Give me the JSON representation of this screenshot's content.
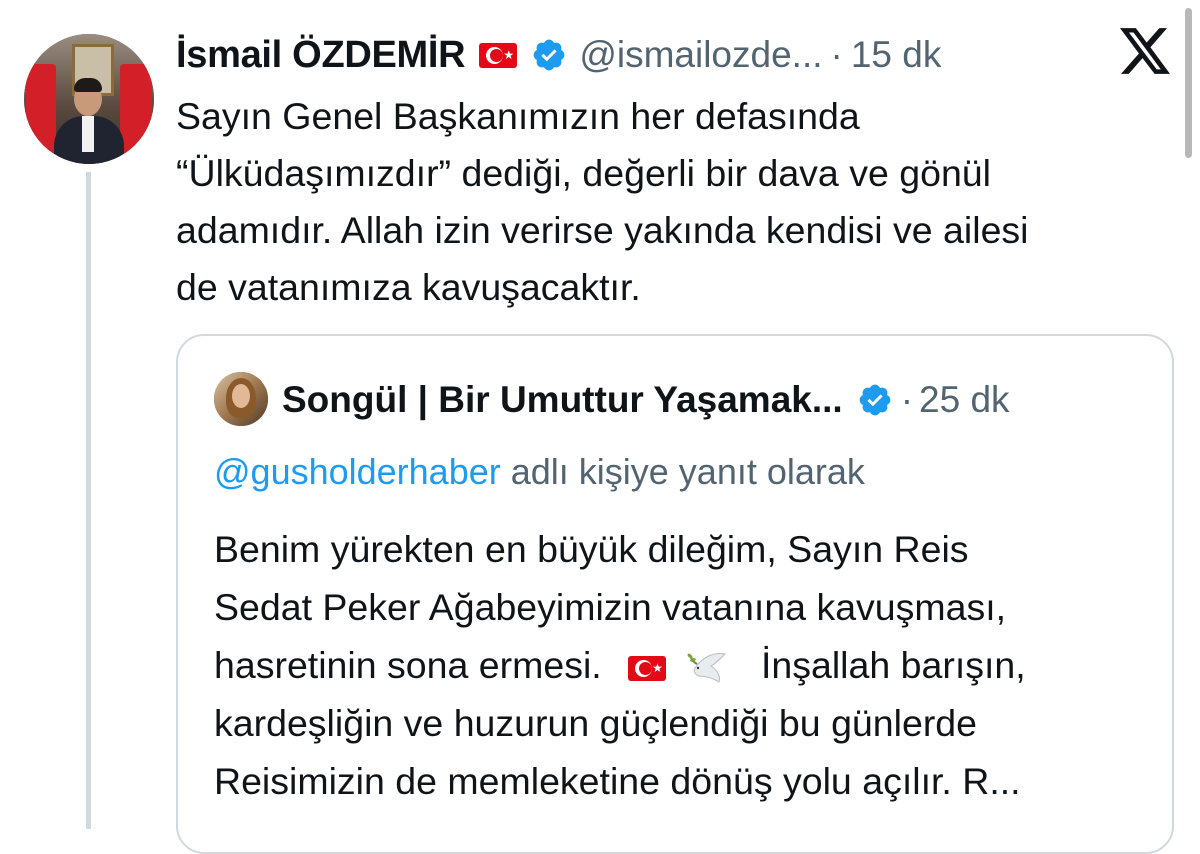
{
  "tweet": {
    "author_name": "İsmail ÖZDEMİR",
    "author_flag": "turkey-flag-emoji",
    "verified": true,
    "handle": "@ismailozde...",
    "separator": "·",
    "time": "15 dk",
    "text_lines": [
      "Sayın Genel Başkanımızın her defasında",
      "“Ülküdaşımızdır” dediği, değerli bir dava ve gönül",
      "adamıdır. Allah izin verirse yakında kendisi ve ailesi",
      "de vatanımıza kavuşacaktır."
    ]
  },
  "quote": {
    "author_name": "Songül | Bir Umuttur Yaşamak...",
    "verified": true,
    "separator": "·",
    "time": "25 dk",
    "reply_mention": "@gusholderhaber",
    "reply_text": "adlı kişiye yanıt olarak",
    "text_line1": "Benim yürekten en büyük dileğim, Sayın Reis",
    "text_line2": "Sedat Peker Ağabeyimizin vatanına kavuşması,",
    "text_line3_a": "hasretinin sona ermesi.",
    "text_line3_emojis": [
      "turkey-flag-emoji",
      "dove-with-olive-branch-emoji"
    ],
    "text_line3_b": "İnşallah barışın,",
    "text_line4": "kardeşliğin ve huzurun güçlendiği bu günlerde",
    "text_line5": "Reisimizin de memleketine dönüş yolu açılır. R..."
  },
  "icons": {
    "verified": "verified-badge-icon",
    "platform": "x-logo-icon"
  },
  "colors": {
    "verified_blue": "#1d9bf0",
    "mention_blue": "#1d9bf0",
    "secondary_text": "#536471",
    "border": "#cfd9de"
  }
}
